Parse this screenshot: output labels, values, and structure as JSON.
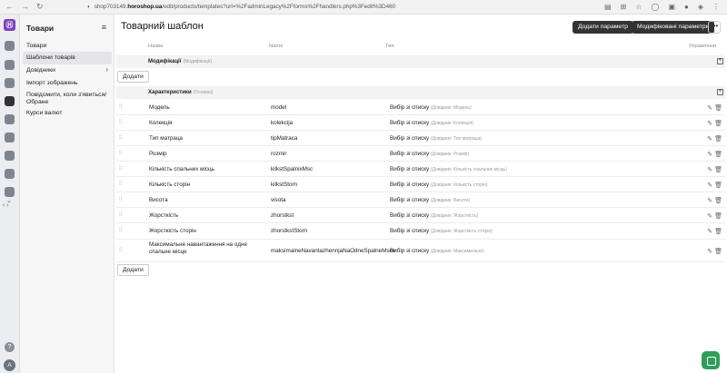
{
  "browser": {
    "url_prefix": "shop703149.",
    "url_host": "horoshop.ua",
    "url_rest": "/edit/products/templates?url=%2FadminLegacy%2Fforms%2Fhandlers.php%3Fedit%3D460"
  },
  "sidebar": {
    "title": "Товари",
    "items": [
      {
        "label": "Товари"
      },
      {
        "label": "Шаблони товарів"
      },
      {
        "label": "Довідники"
      },
      {
        "label": "Імпорт зображень"
      },
      {
        "label": "Повідомити, коли з'явиться/ Обране"
      },
      {
        "label": "Курси валют"
      }
    ]
  },
  "user": {
    "avatar_letter": "A"
  },
  "header": {
    "title": "Товарний шаблон",
    "add_param_label": "Додати параметр",
    "modified_params_label": "Модифіковані параметри",
    "more_label": "•••"
  },
  "columns": {
    "name": "Назва",
    "code": "Name",
    "type": "Тип",
    "actions": "Управління"
  },
  "groups": {
    "modifications": {
      "title": "Модифікації",
      "hint": "(Модифікації)"
    },
    "characteristics": {
      "title": "Характеристики",
      "hint": "(Основні)"
    }
  },
  "buttons": {
    "add": "Додати"
  },
  "rows": [
    {
      "name": "Модель",
      "code": "model",
      "type": "Вибір зі списку",
      "dict": "(Довідник: Модель)"
    },
    {
      "name": "Колекція",
      "code": "kolekcija",
      "type": "Вибір зі списку",
      "dict": "(Довідник: Колекція)"
    },
    {
      "name": "Тип матраца",
      "code": "tipMatraca",
      "type": "Вибір зі списку",
      "dict": "(Довідник: Тип матраца)"
    },
    {
      "name": "Розмір",
      "code": "rozmir",
      "type": "Вибір зі списку",
      "dict": "(Довідник: Розмір)"
    },
    {
      "name": "Кількість спальних місць",
      "code": "kilkstSpalnixMsc",
      "type": "Вибір зі списку",
      "dict": "(Довідник: Кількість спальних місць)"
    },
    {
      "name": "Кількість сторін",
      "code": "kilkstStorn",
      "type": "Вибір зі списку",
      "dict": "(Довідник: Кількість сторін)"
    },
    {
      "name": "Висота",
      "code": "visota",
      "type": "Вибір зі списку",
      "dict": "(Довідник: Висота)"
    },
    {
      "name": "Жорсткість",
      "code": "zhorstkst",
      "type": "Вибір зі списку",
      "dict": "(Довідник: Жорсткість)"
    },
    {
      "name": "Жорсткість сторін",
      "code": "zhorstkstStorn",
      "type": "Вибір зі списку",
      "dict": "(Довідник: Жорсткість сторін)"
    },
    {
      "name": "Максимальне навантаження на одне спальне місце",
      "code": "maksimalneNavantazhennjaNaOdneSpalneMsce",
      "type": "Вибір зі списку",
      "dict": "(Довідник: Максимальне)"
    }
  ],
  "icons": {
    "drag": "drag-handle-icon",
    "edit": "pencil-icon",
    "delete": "trash-icon",
    "add_group": "plus-square-icon"
  }
}
